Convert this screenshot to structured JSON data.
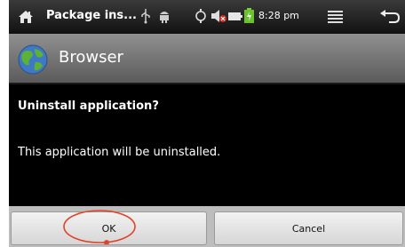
{
  "status_bar": {
    "title": "Package ins...",
    "time": "8:28 pm",
    "icons": [
      "home-icon",
      "usb-icon",
      "android-icon",
      "sync-icon",
      "volume-muted-icon",
      "battery-icon",
      "charging-icon",
      "menu-icon",
      "back-icon"
    ]
  },
  "title_bar": {
    "app_name": "Browser",
    "app_icon": "globe-icon"
  },
  "dialog": {
    "heading": "Uninstall application?",
    "message": "This application will be uninstalled."
  },
  "buttons": {
    "ok_label": "OK",
    "cancel_label": "Cancel"
  },
  "annotation": {
    "shape": "red ellipse around OK button",
    "color": "#e0442a"
  }
}
